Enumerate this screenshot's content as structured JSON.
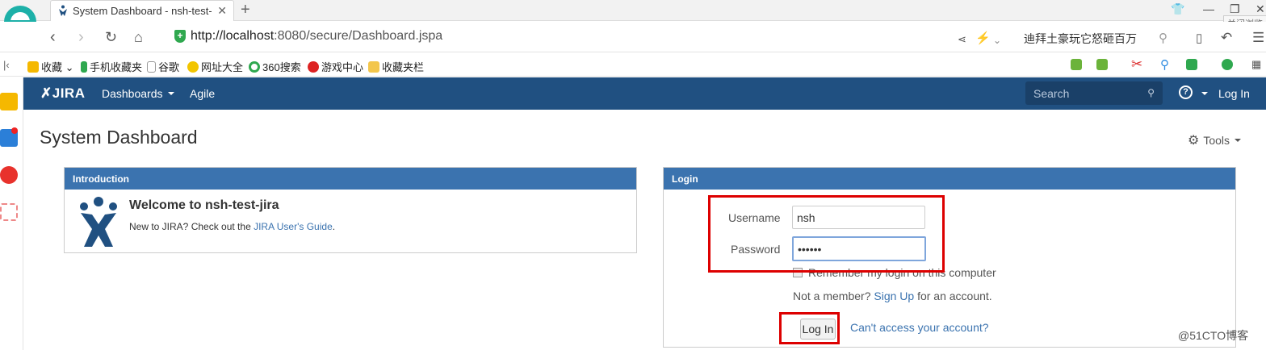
{
  "browser": {
    "tab_title": "System Dashboard - nsh-test-",
    "new_tab": "+",
    "tooltip": "关闭浏览",
    "url_host": "http://localhost",
    "url_rest": ":8080/secure/Dashboard.jspa",
    "search_text": "迪拜土豪玩它怒砸百万",
    "bookmarks": [
      "收藏",
      "手机收藏夹",
      "谷歌",
      "网址大全",
      "360搜索",
      "游戏中心",
      "收藏夹栏"
    ]
  },
  "jira": {
    "logo": "JIRA",
    "nav": {
      "dashboards": "Dashboards",
      "agile": "Agile"
    },
    "search_placeholder": "Search",
    "help": "?",
    "login": "Log In",
    "page_title": "System Dashboard",
    "tools": "Tools",
    "intro": {
      "header": "Introduction",
      "welcome": "Welcome to nsh-test-jira",
      "new_to": "New to JIRA? Check out the ",
      "guide_link": "JIRA User's Guide",
      "period": "."
    },
    "login_gadget": {
      "header": "Login",
      "username_label": "Username",
      "username_value": "nsh",
      "password_label": "Password",
      "password_value": "••••••",
      "remember": "Remember my login on this computer",
      "not_member": "Not a member? ",
      "signup": "Sign Up",
      "for_account": " for an account.",
      "login_button": "Log In",
      "cant_access": "Can't access your account?"
    }
  },
  "watermark": "@51CTO博客",
  "colors": {
    "header": "#205081",
    "gadget_header": "#3b73af",
    "highlight": "#dd0000"
  }
}
